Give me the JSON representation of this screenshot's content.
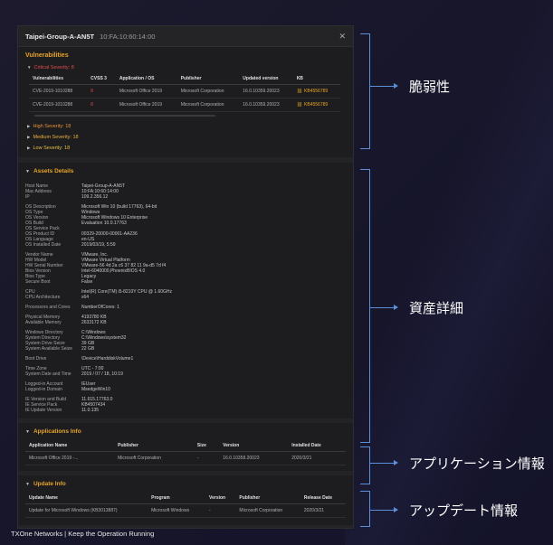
{
  "window": {
    "hostname": "Taipei-Group-A-AN5T",
    "mac": "10:FA:10:60:14:00",
    "close_glyph": "✕"
  },
  "vulnerabilities": {
    "title": "Vulnerabilities",
    "critical_label": "Critical Severity: 8",
    "columns": [
      "Vulnerabilities",
      "CVSS 3",
      "Application / OS",
      "Publisher",
      "Updated version",
      "KB"
    ],
    "rows": [
      [
        "CVE-2019-1010288",
        "8",
        "Microsoft Office 2019",
        "Microsoft Corporation",
        "16.0.10359.20023",
        "KB4556789"
      ],
      [
        "CVE-2019-1010288",
        "8",
        "Microsoft Office 2019",
        "Microsoft Corporation",
        "16.0.10359.20023",
        "KB4556789"
      ]
    ],
    "high_label": "High Severity: 18",
    "medium_label": "Medium Severity: 18",
    "low_label": "Low Severity: 18"
  },
  "assets": {
    "title": "Assets Details",
    "groups": [
      [
        [
          "Host Name",
          "Taipei-Group-A-AN5T"
        ],
        [
          "Mac Address",
          "10:FA:10:60:14:00"
        ],
        [
          "IP",
          "109.2.356.12"
        ]
      ],
      [
        [
          "OS Description",
          "Microsoft Win 10 (build 17763), 64-bit"
        ],
        [
          "OS Type",
          "Windows"
        ],
        [
          "OS Version",
          "Microsoft Windows 10 Enterprise"
        ],
        [
          "OS Build",
          "Evaluation 10.0.17763"
        ],
        [
          "OS Service Pack",
          ""
        ],
        [
          "OS Product ID",
          "00329-20000-00001-AA236"
        ],
        [
          "OS Language",
          "en-US"
        ],
        [
          "OS Installed Date",
          "2019/03/19, 5:59"
        ]
      ],
      [
        [
          "Vendor Name",
          "VMware, Inc."
        ],
        [
          "HW Model",
          "VMware Virtual Platform"
        ],
        [
          "HW Serial Number",
          "VMware-56 4d 2a c6 37 82 11 9a-d5 7d f4"
        ],
        [
          "Bios Version",
          "Intel-6040000,PhoenixBIOS 4.0"
        ],
        [
          "Bios Type",
          "Legacy"
        ],
        [
          "Secure Boot",
          "False"
        ]
      ],
      [
        [
          "CPU",
          "Intel(R) Core(TM) i5-8210Y CPU @ 1.60GHz"
        ],
        [
          "CPU Architecture",
          "x64"
        ]
      ],
      [
        [
          "Processors and Cores",
          "NumberOfCores: 1"
        ]
      ],
      [
        [
          "Physical Memory",
          "4193780 KB"
        ],
        [
          "Available Memory",
          "2633172 KB"
        ]
      ],
      [
        [
          "Windows Directory",
          "C:\\Windows"
        ],
        [
          "System Directory",
          "C:\\Windows\\system32"
        ],
        [
          "System Drive Seize",
          "39 GB"
        ],
        [
          "System Available Seize",
          "22 GB"
        ]
      ],
      [
        [
          "Boot Drive",
          "\\Device\\HarddiskVolume1"
        ]
      ],
      [
        [
          "Time Zone",
          "UTC - 7:00"
        ],
        [
          "System Date and Time",
          "2019 / 07 / 18, 10:19"
        ]
      ],
      [
        [
          "Logged-in Account",
          "IEUser"
        ],
        [
          "Logged-in Domain",
          "MsedgeWin10"
        ]
      ],
      [
        [
          "IE Version and Build",
          "11.615.17763.0"
        ],
        [
          "IE Service Pack",
          "KB4507434"
        ],
        [
          "IE Update Version",
          "11.0.135"
        ]
      ]
    ]
  },
  "applications": {
    "title": "Applications Info",
    "columns": [
      "Application Name",
      "Publisher",
      "Size",
      "Version",
      "Installed Date"
    ],
    "rows": [
      [
        "Microsoft Office 2019 -...",
        "Microsoft Corporation",
        "-",
        "16.0.10358.20023",
        "2020/3/21"
      ]
    ]
  },
  "updates": {
    "title": "Update Info",
    "columns": [
      "Update Name",
      "Program",
      "Version",
      "Publisher",
      "Release Date"
    ],
    "rows": [
      [
        "Update for Microsoft Windows (KB3013887)",
        "Microsoft Windows",
        "-",
        "Microsoft Corporation",
        "2020/3/21"
      ]
    ]
  },
  "annotations": {
    "vulnerability": "脆弱性",
    "assets": "資産詳細",
    "applications": "アプリケーション情報",
    "updates": "アップデート情報"
  },
  "footer": "TXOne Networks  |  Keep the Operation Running",
  "colors": {
    "accent": "#e8a526",
    "critical": "#e04b4b",
    "annotation_line": "#5b8fd8"
  }
}
